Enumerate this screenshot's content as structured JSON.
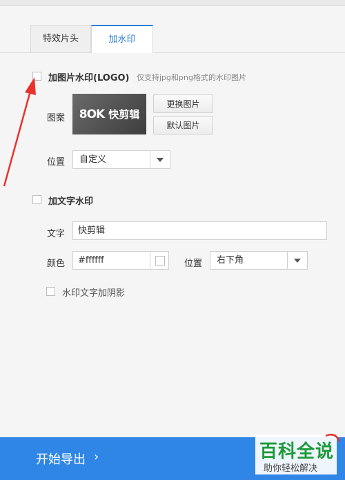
{
  "tabs": [
    {
      "label": "特效片头"
    },
    {
      "label": "加水印"
    }
  ],
  "image_watermark": {
    "checkbox_label": "加图片水印(LOGO)",
    "hint": "仅支持jpg和png格式的水印图片",
    "image_label": "图案",
    "logo_mark": "8OK",
    "logo_text": "快剪辑",
    "replace_button": "更换图片",
    "default_button": "默认图片",
    "position_label": "位置",
    "position_value": "自定义"
  },
  "text_watermark": {
    "checkbox_label": "加文字水印",
    "text_label": "文字",
    "text_value": "快剪辑",
    "color_label": "颜色",
    "color_value": "#ffffff",
    "position_label": "位置",
    "position_value": "右下角",
    "shadow_label": "水印文字加阴影"
  },
  "footer": {
    "export_label": "开始导出",
    "chevron": "›"
  },
  "site_watermark": {
    "title": "百科全说",
    "subtitle": "助你轻松解决"
  },
  "colors": {
    "accent": "#2a7fd4",
    "footer_bg": "#2f86e6",
    "annotation_arrow": "#e8322b",
    "brand_green": "#1e9a3a"
  }
}
